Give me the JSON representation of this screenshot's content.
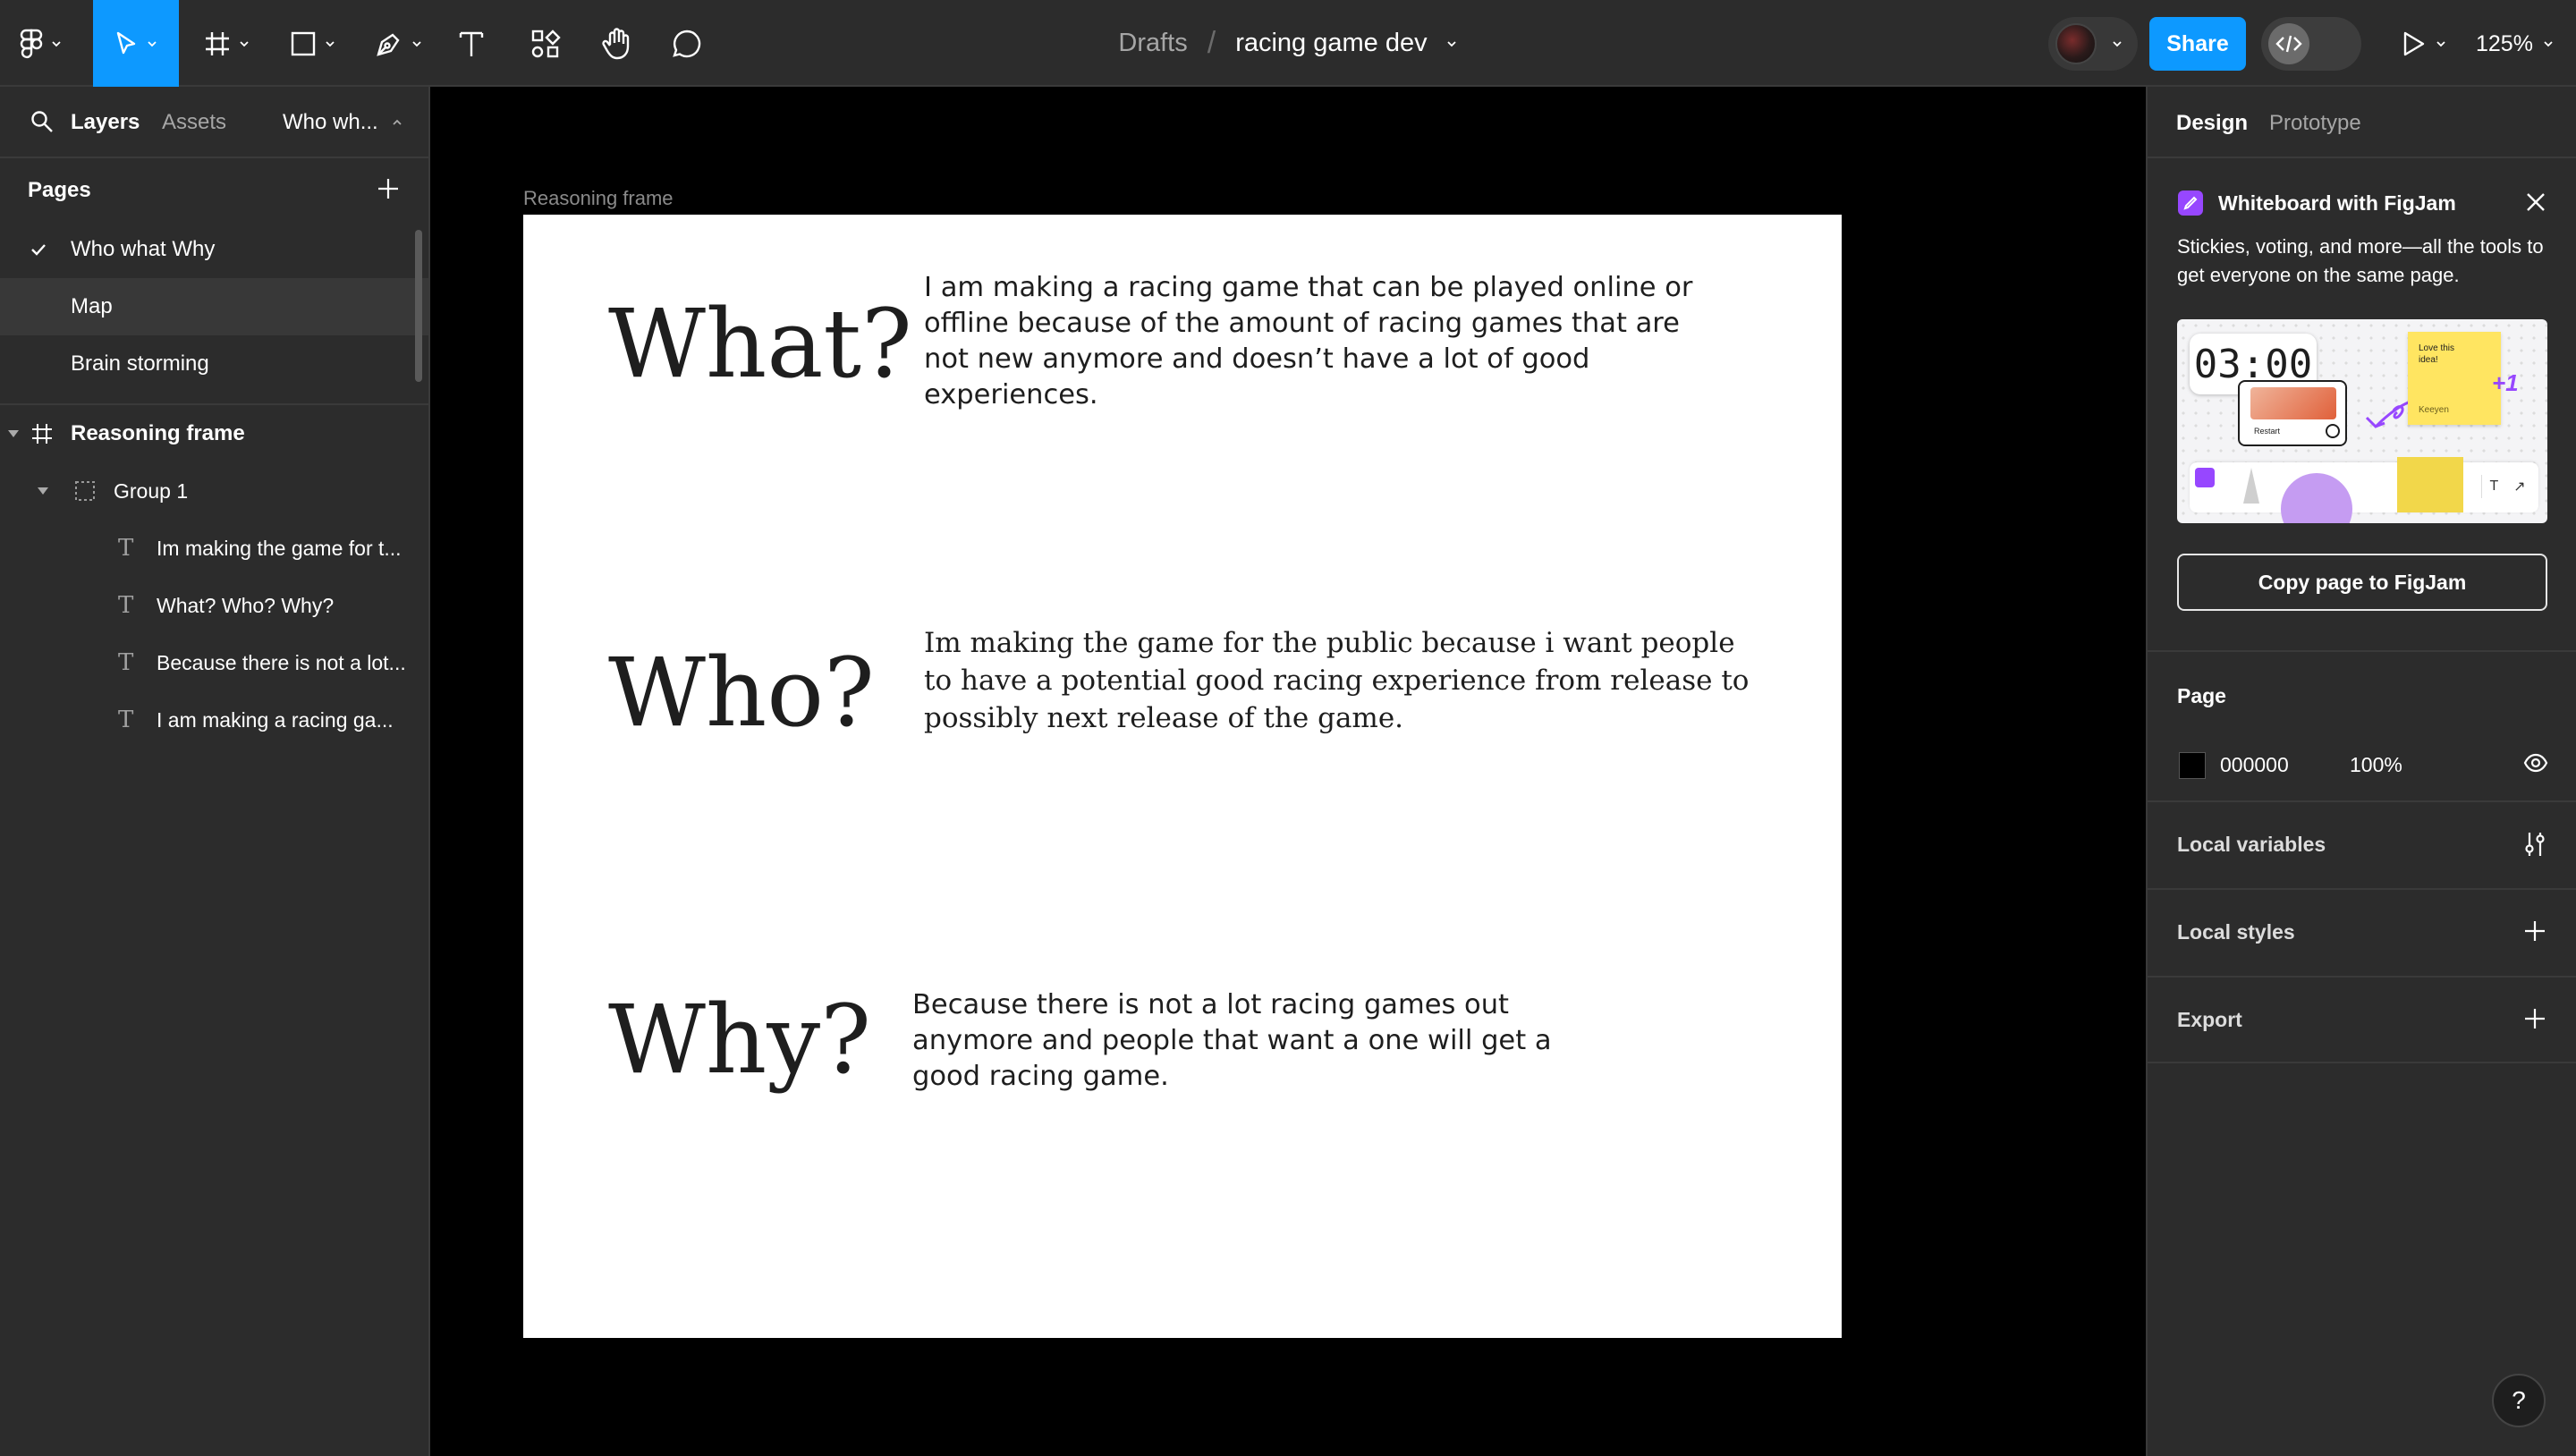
{
  "toolbar": {
    "breadcrumb_parent": "Drafts",
    "breadcrumb_sep": "/",
    "file_name": "racing game dev",
    "share_label": "Share",
    "zoom_label": "125%"
  },
  "left_panel": {
    "tab_layers": "Layers",
    "tab_assets": "Assets",
    "current_page": "Who wh...",
    "pages_title": "Pages",
    "pages": [
      {
        "label": "Who what Why",
        "checked": true
      },
      {
        "label": "Map"
      },
      {
        "label": "Brain storming"
      }
    ],
    "layers": [
      {
        "label": "Reasoning frame",
        "kind": "frame"
      },
      {
        "label": "Group 1",
        "kind": "group"
      },
      {
        "label": "Im making the game for t...",
        "kind": "text"
      },
      {
        "label": "What? Who? Why?",
        "kind": "text"
      },
      {
        "label": "Because there is not a lot...",
        "kind": "text"
      },
      {
        "label": "I am making a racing ga...",
        "kind": "text"
      }
    ]
  },
  "canvas": {
    "frame_label": "Reasoning frame",
    "what_heading": "What?",
    "who_heading": "Who?",
    "why_heading": "Why?",
    "what_lines": [
      "I am making a racing game that can be played online or",
      "offline because of the amount of racing games that are",
      "not new anymore and doesn’t have a lot of good",
      "experiences."
    ],
    "who_lines": [
      "Im making the game for the public because i want people",
      "to have a potential good racing experience from release to",
      "possibly next release of the game."
    ],
    "why_lines": [
      "Because there is not a lot racing games out",
      "anymore and people that want a one will get a",
      "good racing game."
    ]
  },
  "right_panel": {
    "tab_design": "Design",
    "tab_prototype": "Prototype",
    "promo_title": "Whiteboard with FigJam",
    "promo_desc": "Stickies, voting, and more—all the tools to get everyone on the same page.",
    "promo_image": {
      "timer": "03:00",
      "sticky_text": "Love this idea!",
      "sticky_author": "Keeyen",
      "plus_one": "+1",
      "restart": "Restart"
    },
    "copy_button": "Copy page to FigJam",
    "page_section": "Page",
    "page_color_hex": "000000",
    "page_opacity": "100%",
    "local_variables": "Local variables",
    "local_styles": "Local styles",
    "export": "Export"
  },
  "help": "?",
  "colors": {
    "accent": "#0d99ff",
    "panel_bg": "#2c2c2c",
    "canvas_bg": "#000000",
    "frame_bg": "#ffffff",
    "figjam_purple": "#9747ff"
  },
  "icons": {
    "main_menu": "figma-logo-icon",
    "move": "cursor-arrow-icon",
    "frame": "hash-frame-icon",
    "shape": "rectangle-icon",
    "pen": "pen-icon",
    "text": "text-icon",
    "resources": "resources-icon",
    "hand": "hand-icon",
    "comment": "comment-icon",
    "dev_mode": "code-icon",
    "present": "play-icon"
  }
}
